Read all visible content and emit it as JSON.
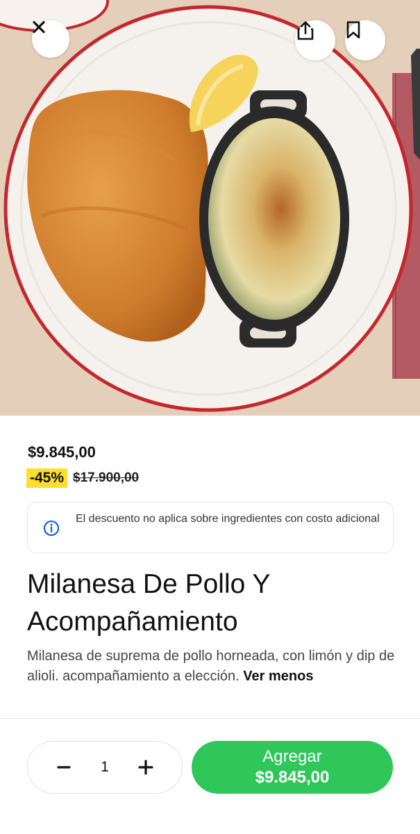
{
  "hero": {
    "image": "milanesa-plate-photo",
    "icons": {
      "close": "close-icon",
      "share": "share-icon",
      "bookmark": "bookmark-icon"
    }
  },
  "pricing": {
    "price": "$9.845,00",
    "discount_badge": "-45%",
    "original_price": "$17.900,00"
  },
  "info_notice": {
    "icon": "info-icon",
    "text": "El descuento no aplica sobre ingredientes con costo adicional"
  },
  "product": {
    "title_line1": "Milanesa De Pollo Y",
    "title_line2": "Acompañamiento",
    "description": "Milanesa de suprema de pollo horneada, con limón y dip de alioli. acompañamiento a elección. ",
    "toggle_label": "Ver menos"
  },
  "cart": {
    "quantity": "1",
    "add_label": "Agregar",
    "add_price": "$9.845,00"
  },
  "colors": {
    "accent_green": "#2fc65a",
    "badge_yellow": "#ffde2e",
    "info_blue": "#1565d8"
  }
}
